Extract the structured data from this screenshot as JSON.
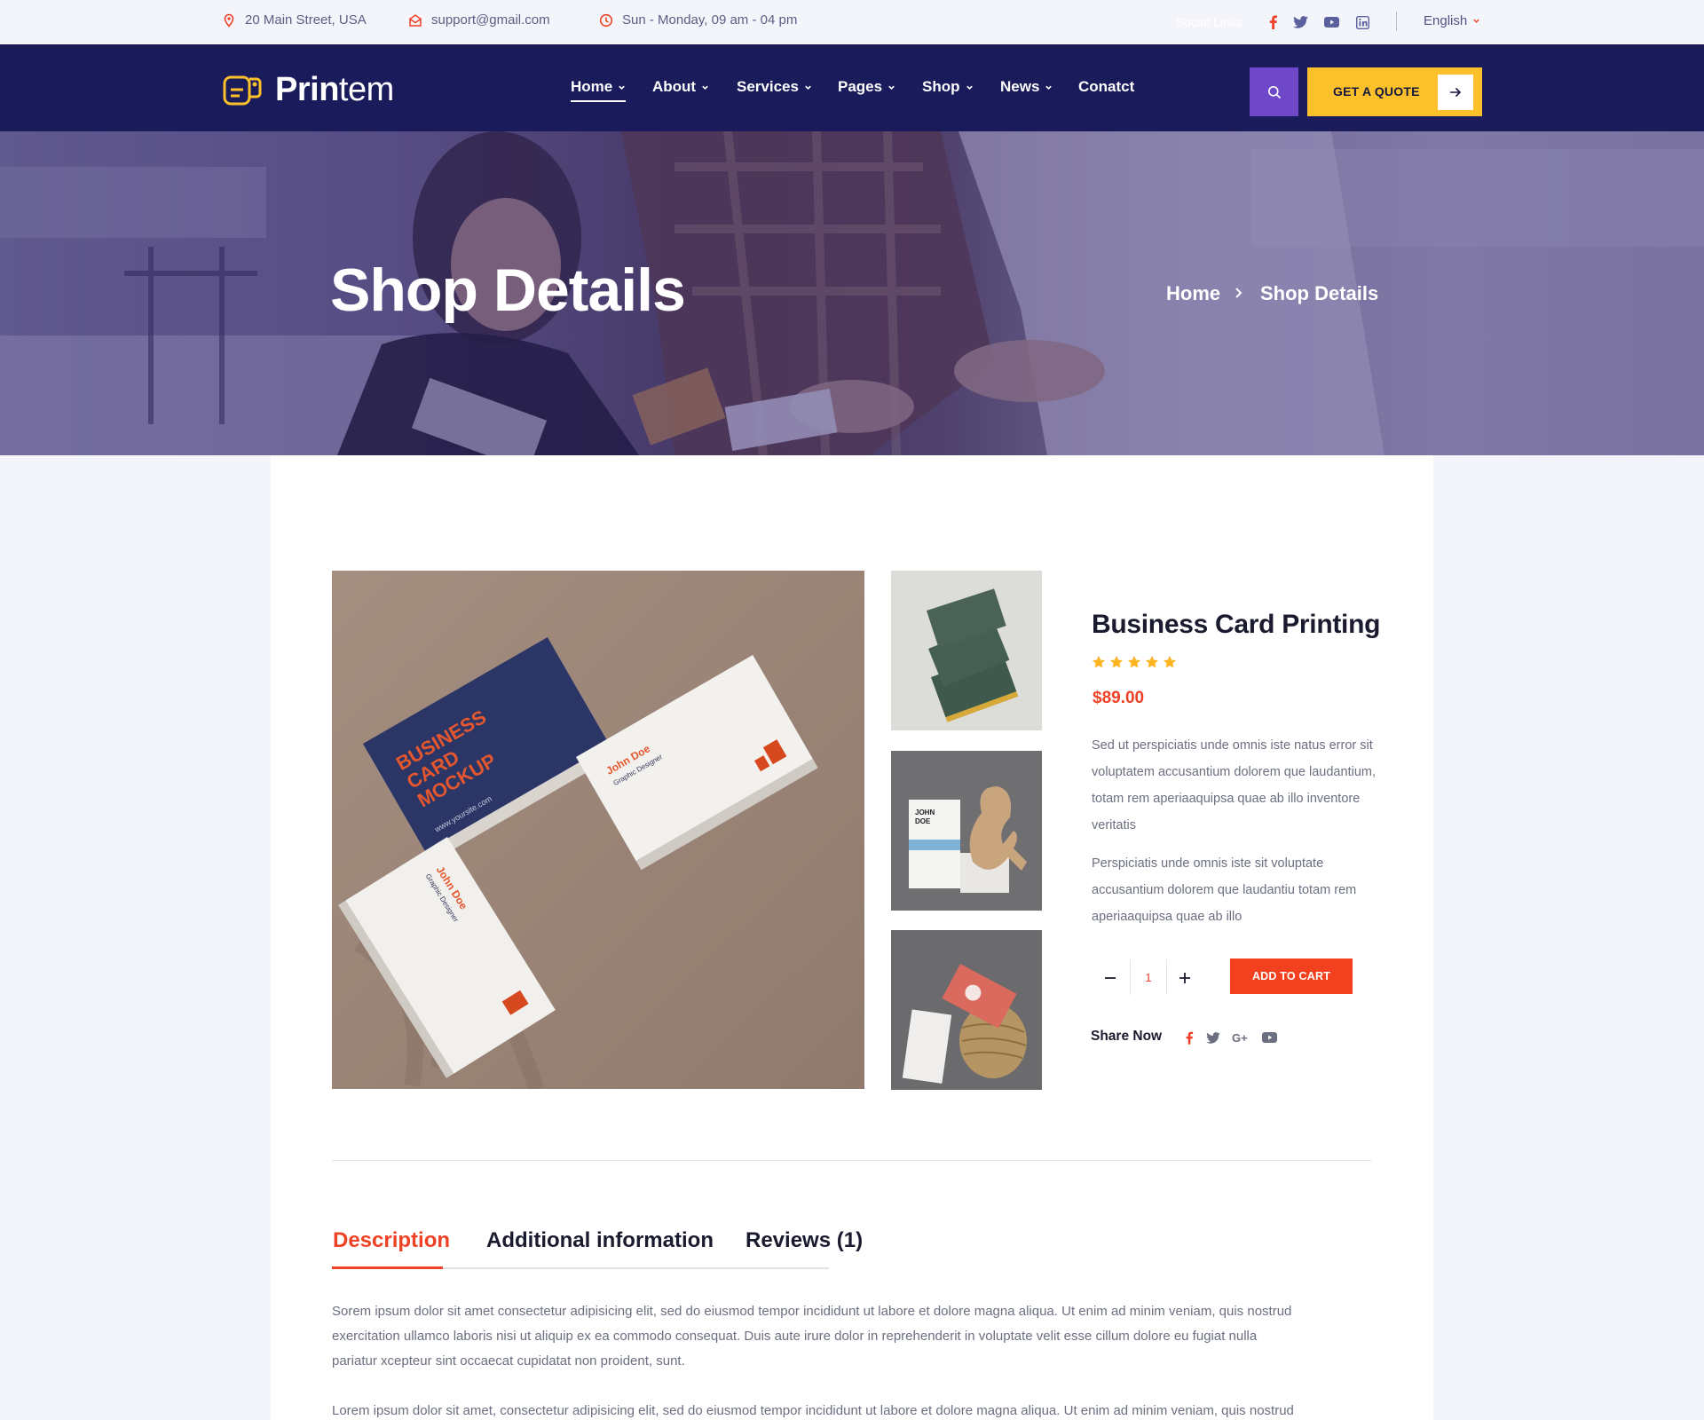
{
  "topbar": {
    "address": "20 Main Street, USA",
    "email": "support@gmail.com",
    "hours": "Sun - Monday, 09 am - 04 pm",
    "social_label": "Social Links",
    "language": "English"
  },
  "brand": {
    "logo_bold": "Prin",
    "logo_light": "tem"
  },
  "nav": {
    "items": [
      {
        "label": "Home"
      },
      {
        "label": "About"
      },
      {
        "label": "Services"
      },
      {
        "label": "Pages"
      },
      {
        "label": "Shop"
      },
      {
        "label": "News"
      },
      {
        "label": "Conatct"
      }
    ],
    "quote_label": "GET A QUOTE"
  },
  "hero": {
    "title": "Shop Details",
    "breadcrumb_home": "Home",
    "breadcrumb_current": "Shop Details"
  },
  "product": {
    "name": "Business Card Printing",
    "rating": 5,
    "price": "$89.00",
    "desc_1": "Sed ut perspiciatis unde omnis iste natus error sit voluptatem accusantium dolorem que laudantium, totam rem aperiaaquipsa quae ab illo inventore veritatis",
    "desc_2": "Perspiciatis unde omnis iste sit voluptate accusantium dolorem que laudantiu totam rem aperiaaquipsa quae ab illo",
    "quantity": "1",
    "add_to_cart": "ADD TO CART",
    "share_label": "Share Now",
    "main_image": {
      "card_title": "BUSINESS CARD MOCKUP",
      "site": "www.yoursite.com",
      "person_name": "John Doe",
      "person_role": "Graphic Designer"
    },
    "thumb_2_text": "JOHN DOE"
  },
  "tabs": {
    "items": [
      {
        "label": "Description"
      },
      {
        "label": "Additional information"
      },
      {
        "label": "Reviews (1)"
      }
    ],
    "active_index": 0
  },
  "description": {
    "para_1": "Sorem ipsum dolor sit amet consectetur adipisicing elit, sed do eiusmod tempor incididunt ut labore et dolore magna aliqua. Ut enim ad minim veniam, quis nostrud exercitation ullamco laboris nisi ut aliquip ex ea commodo consequat. Duis aute irure dolor in reprehenderit in voluptate velit esse cillum dolore eu fugiat nulla pariatur xcepteur sint occaecat cupidatat non proident, sunt.",
    "para_2": "Lorem ipsum dolor sit amet, consectetur adipisicing elit, sed do eiusmod tempor incididunt ut labore et dolore magna aliqua. Ut enim ad minim veniam, quis nostrud"
  },
  "colors": {
    "navy": "#191b5b",
    "accent_red": "#ef4126",
    "accent_yellow": "#fcc02a",
    "accent_purple": "#6e48c9"
  },
  "icons": {
    "address": "map-pin-icon",
    "email": "envelope-icon",
    "hours": "clock-icon",
    "search": "search-icon",
    "arrow": "arrow-right-icon"
  }
}
